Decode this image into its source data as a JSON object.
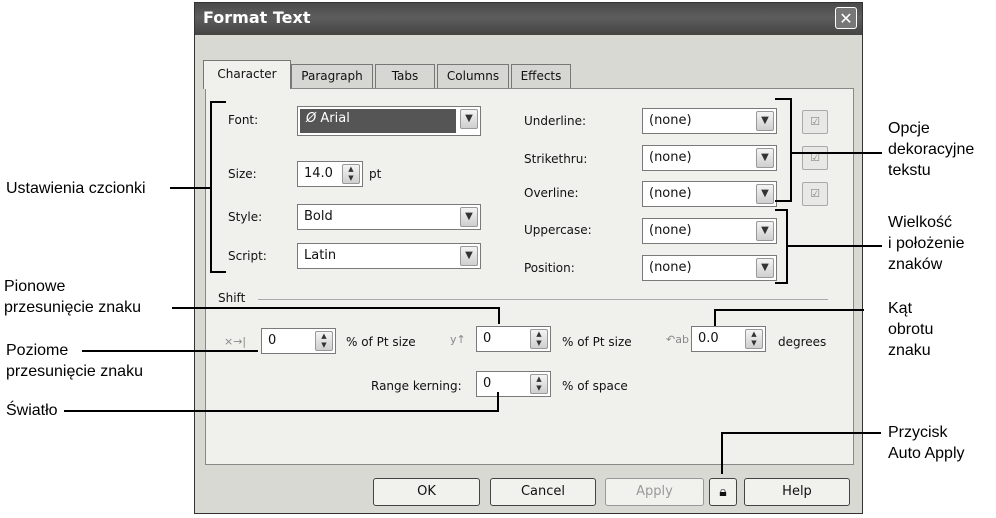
{
  "dialog": {
    "title": "Format Text",
    "close_label": "✕"
  },
  "tabs": [
    "Character",
    "Paragraph",
    "Tabs",
    "Columns",
    "Effects"
  ],
  "character": {
    "font_label": "Font:",
    "font_value": "Arial",
    "size_label": "Size:",
    "size_value": "14.0",
    "size_unit": "pt",
    "style_label": "Style:",
    "style_value": "Bold",
    "script_label": "Script:",
    "script_value": "Latin",
    "underline_label": "Underline:",
    "underline_value": "(none)",
    "strikethru_label": "Strikethru:",
    "strikethru_value": "(none)",
    "overline_label": "Overline:",
    "overline_value": "(none)",
    "uppercase_label": "Uppercase:",
    "uppercase_value": "(none)",
    "position_label": "Position:",
    "position_value": "(none)"
  },
  "shift": {
    "group_label": "Shift",
    "horizontal_value": "0",
    "horizontal_unit": "% of Pt size",
    "vertical_value": "0",
    "vertical_unit": "% of Pt size",
    "rotation_value": "0.0",
    "rotation_unit": "degrees",
    "kerning_label": "Range kerning:",
    "kerning_value": "0",
    "kerning_unit": "% of space"
  },
  "buttons": {
    "ok": "OK",
    "cancel": "Cancel",
    "apply": "Apply",
    "help": "Help"
  },
  "annotations": {
    "font_settings": "Ustawienia czcionki",
    "decoration_1": "Opcje",
    "decoration_2": "dekoracyjne",
    "decoration_3": "tekstu",
    "case_1": "Wielkość",
    "case_2": "i położenie",
    "case_3": "znaków",
    "vertical_1": "Pionowe",
    "vertical_2": "przesunięcie znaku",
    "horizontal_1": "Poziome",
    "horizontal_2": "przesunięcie znaku",
    "rotation_1": "Kąt",
    "rotation_2": "obrotu",
    "rotation_3": "znaku",
    "kerning": "Światło",
    "autoapply_1": "Przycisk",
    "autoapply_2": "Auto Apply"
  },
  "icons": {
    "combo_arrow": "chevron-down-icon",
    "spin": "spin-updown-icon",
    "lock": "lock-icon",
    "font_type": "opentype-font-icon"
  }
}
